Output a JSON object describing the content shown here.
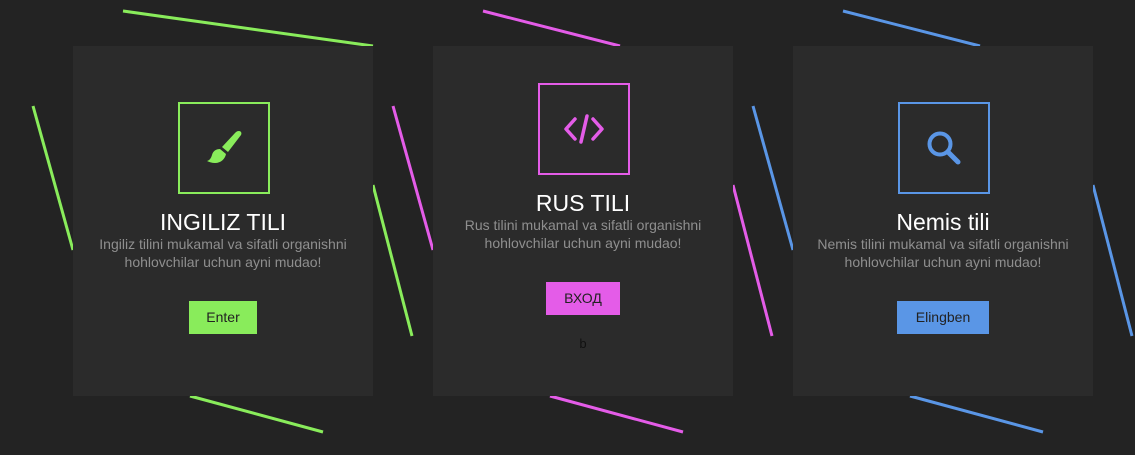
{
  "colors": {
    "background": "#232323",
    "card": "#2b2b2b",
    "green": "#89ec5b",
    "pink": "#e45ce8",
    "blue": "#5a96e6"
  },
  "cards": [
    {
      "icon": "paintbrush-icon",
      "title": "INGILIZ TILI",
      "description": "Ingiliz tilini mukamal va sifatli organishni hohlovchilar uchun ayni mudao!",
      "button": "Enter"
    },
    {
      "icon": "code-icon",
      "title": "RUS TILI",
      "description": "Rus tilini mukamal va sifatli organishni hohlovchilar uchun ayni mudao!",
      "button": "ВХОД",
      "extra": "b"
    },
    {
      "icon": "search-icon",
      "title": "Nemis tili",
      "description": "Nemis tilini mukamal va sifatli organishni hohlovchilar uchun ayni mudao!",
      "button": "Elingben"
    }
  ]
}
